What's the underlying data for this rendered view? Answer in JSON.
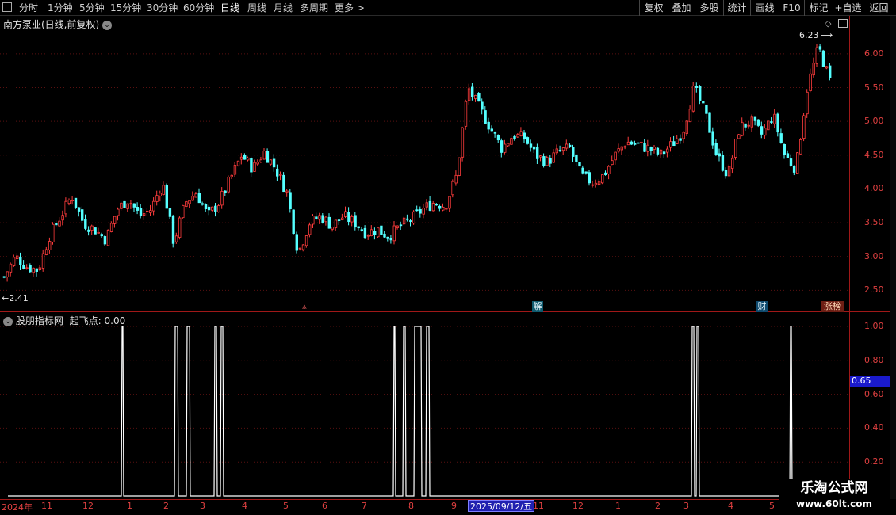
{
  "toolbar": {
    "periods": [
      "分时",
      "1分钟",
      "5分钟",
      "15分钟",
      "30分钟",
      "60分钟",
      "日线",
      "周线",
      "月线",
      "多周期",
      "更多 >"
    ],
    "active_period": "日线",
    "right_buttons": [
      "复权",
      "叠加",
      "多股",
      "统计",
      "画线",
      "F10",
      "标记",
      "+自选",
      "返回"
    ]
  },
  "main_chart": {
    "stock_name": "南方泵业(日线,前复权)",
    "high_label": "6.23",
    "low_label": "2.41",
    "y_ticks": [
      "6.00",
      "5.50",
      "5.00",
      "4.50",
      "4.00",
      "3.50",
      "3.00",
      "2.50"
    ],
    "markers": {
      "jie": "解",
      "cai": "财",
      "zhangting": "涨榜"
    }
  },
  "indicator": {
    "title": "股朋指标网",
    "param_label": "起飞点:",
    "param_value": "0.00",
    "y_ticks": [
      "1.00",
      "0.80",
      "0.60",
      "0.40",
      "0.20"
    ],
    "current_value": "0.65"
  },
  "x_axis": {
    "labels": [
      "2024年",
      "11",
      "12",
      "1",
      "2",
      "3",
      "4",
      "5",
      "6",
      "7",
      "8",
      "9",
      "11",
      "12",
      "1",
      "2",
      "3",
      "4",
      "5"
    ],
    "cursor_date": "2025/09/12/五"
  },
  "watermark": {
    "line1": "乐淘公式网",
    "line2": "www.60lt.com"
  },
  "chart_data": {
    "type": "candlestick",
    "price_range": [
      2.2,
      6.35
    ],
    "series_close": [
      2.7,
      3.0,
      2.85,
      2.8,
      3.3,
      3.6,
      3.9,
      3.5,
      3.4,
      3.25,
      3.7,
      3.85,
      3.6,
      3.7,
      4.1,
      3.2,
      3.8,
      3.95,
      3.6,
      3.8,
      4.15,
      4.5,
      4.3,
      4.55,
      4.3,
      3.95,
      3.05,
      3.5,
      3.6,
      3.45,
      3.6,
      3.5,
      3.35,
      3.4,
      3.3,
      3.45,
      3.55,
      3.7,
      3.8,
      3.75,
      4.2,
      5.5,
      5.2,
      4.9,
      4.6,
      4.8,
      4.75,
      4.5,
      4.4,
      4.55,
      4.6,
      4.2,
      4.1,
      4.2,
      4.5,
      4.7,
      4.65,
      4.6,
      4.5,
      4.65,
      4.85,
      5.5,
      5.1,
      4.5,
      4.2,
      4.9,
      5.0,
      4.8,
      5.1,
      4.5,
      4.3,
      5.5,
      6.1,
      5.6
    ],
    "indicator_signal_ranges": [
      [
        153,
        156
      ],
      [
        220,
        225
      ],
      [
        235,
        240
      ],
      [
        270,
        274
      ],
      [
        278,
        282
      ],
      [
        496,
        499
      ],
      [
        508,
        512
      ],
      [
        522,
        532
      ],
      [
        537,
        542
      ],
      [
        872,
        876
      ],
      [
        878,
        882
      ],
      [
        996,
        999
      ]
    ]
  }
}
